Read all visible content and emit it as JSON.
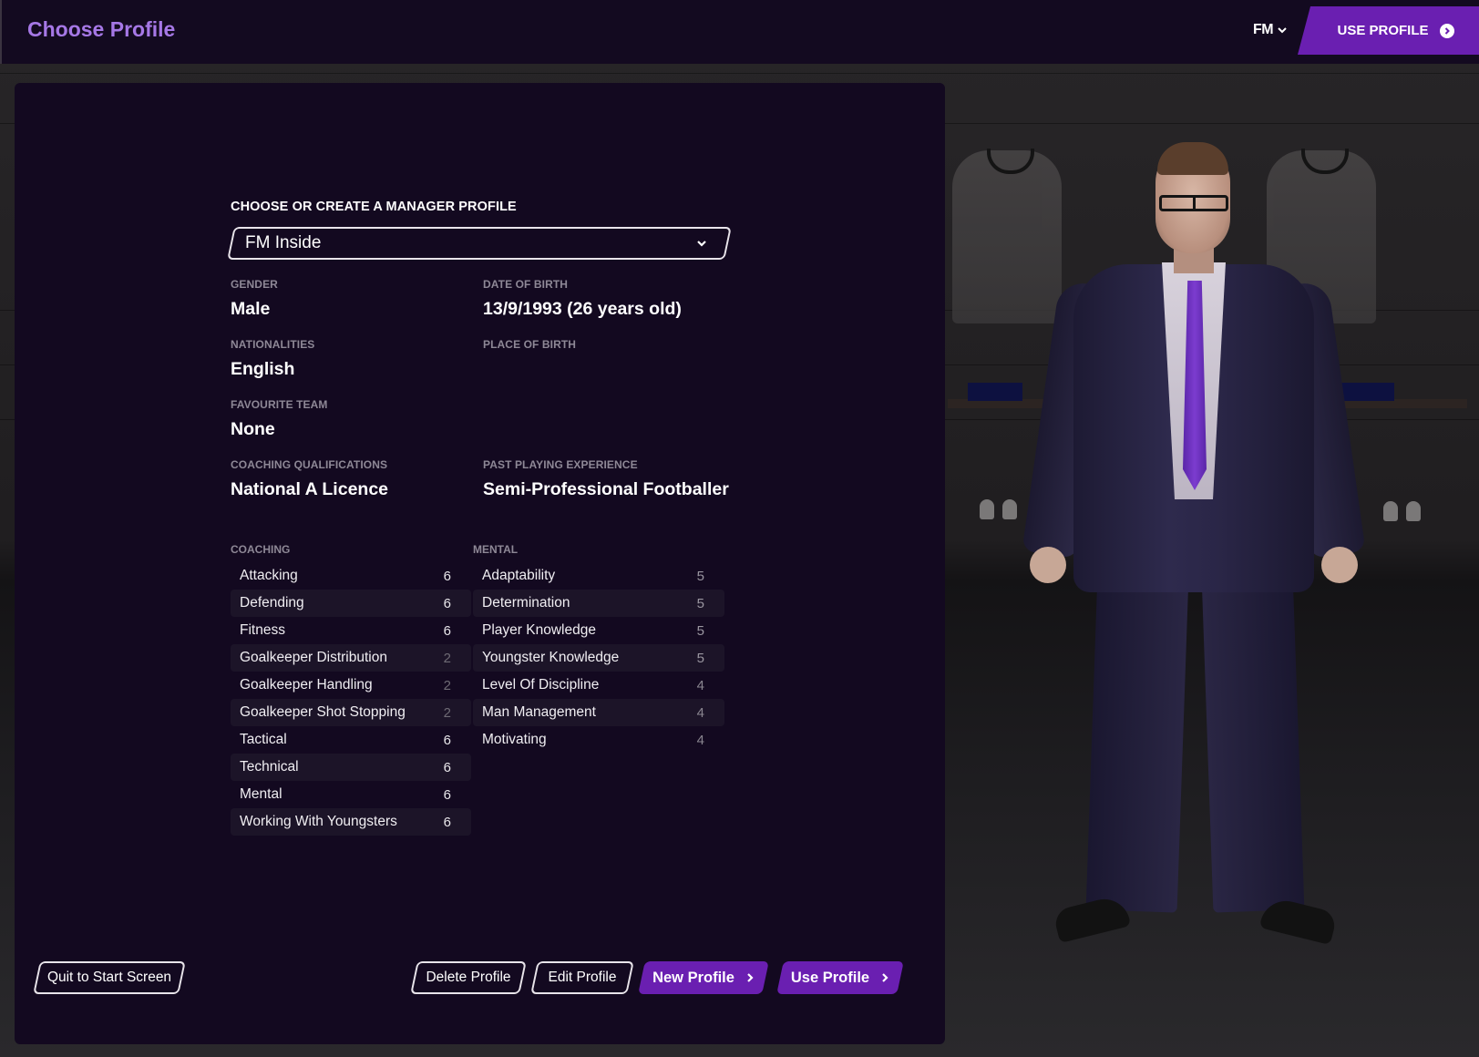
{
  "header": {
    "title": "Choose Profile",
    "fm_menu_label": "FM",
    "use_profile_label": "USE PROFILE"
  },
  "profile_form": {
    "heading": "CHOOSE OR CREATE A MANAGER PROFILE",
    "selected_profile": "FM Inside",
    "fields": [
      {
        "label": "GENDER",
        "value": "Male"
      },
      {
        "label": "DATE OF BIRTH",
        "value": "13/9/1993 (26 years old)"
      },
      {
        "label": "NATIONALITIES",
        "value": "English"
      },
      {
        "label": "PLACE OF BIRTH",
        "value": ""
      },
      {
        "label": "FAVOURITE TEAM",
        "value": "None"
      },
      {
        "label": "",
        "value": ""
      },
      {
        "label": "COACHING QUALIFICATIONS",
        "value": "National A Licence"
      },
      {
        "label": "PAST PLAYING EXPERIENCE",
        "value": "Semi-Professional Footballer"
      }
    ]
  },
  "attributes": {
    "coaching": {
      "heading": "COACHING",
      "items": [
        {
          "name": "Attacking",
          "value": "6"
        },
        {
          "name": "Defending",
          "value": "6"
        },
        {
          "name": "Fitness",
          "value": "6"
        },
        {
          "name": "Goalkeeper Distribution",
          "value": "2"
        },
        {
          "name": "Goalkeeper Handling",
          "value": "2"
        },
        {
          "name": "Goalkeeper Shot Stopping",
          "value": "2"
        },
        {
          "name": "Tactical",
          "value": "6"
        },
        {
          "name": "Technical",
          "value": "6"
        },
        {
          "name": "Mental",
          "value": "6"
        },
        {
          "name": "Working With Youngsters",
          "value": "6"
        }
      ]
    },
    "mental": {
      "heading": "MENTAL",
      "items": [
        {
          "name": "Adaptability",
          "value": "5"
        },
        {
          "name": "Determination",
          "value": "5"
        },
        {
          "name": "Player Knowledge",
          "value": "5"
        },
        {
          "name": "Youngster Knowledge",
          "value": "5"
        },
        {
          "name": "Level Of Discipline",
          "value": "4"
        },
        {
          "name": "Man Management",
          "value": "4"
        },
        {
          "name": "Motivating",
          "value": "4"
        }
      ]
    }
  },
  "footer": {
    "quit_label": "Quit to Start Screen",
    "delete_label": "Delete Profile",
    "edit_label": "Edit Profile",
    "new_label": "New Profile",
    "use_label": "Use Profile"
  },
  "colors": {
    "accent": "#6a1fb1",
    "title": "#a678e6",
    "panel": "#130920"
  }
}
